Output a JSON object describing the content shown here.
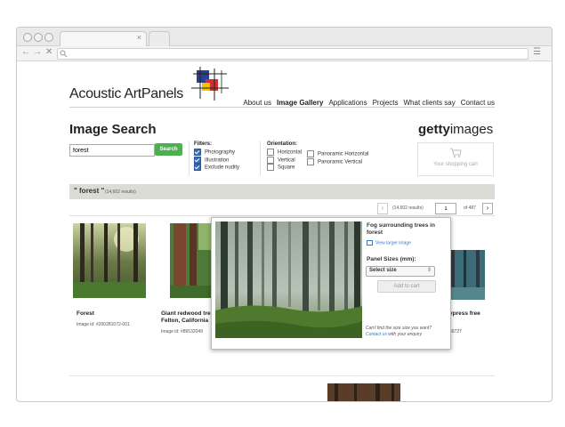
{
  "browser": {
    "tab_close": "×",
    "nav": {
      "back": "←",
      "forward": "→",
      "stop": "✕"
    },
    "url": "",
    "menu_icon": "☰"
  },
  "site": {
    "logo_text": "Acoustic ArtPanels",
    "nav": [
      "About us",
      "Image Gallery",
      "Applications",
      "Projects",
      "What clients say",
      "Contact us"
    ],
    "nav_active_index": 1
  },
  "search": {
    "heading": "Image Search",
    "input_value": "forest",
    "button_label": "Search",
    "filters_label": "Filters:",
    "filters": [
      {
        "label": "Photography",
        "checked": true
      },
      {
        "label": "Illustration",
        "checked": true
      },
      {
        "label": "Exclude nudity",
        "checked": true
      }
    ],
    "orientation_label": "Orientation:",
    "orientation_col1": [
      {
        "label": "Horizontal",
        "checked": false
      },
      {
        "label": "Vertical",
        "checked": false
      },
      {
        "label": "Square",
        "checked": false
      }
    ],
    "orientation_col2": [
      {
        "label": "Panoramic Horizontal",
        "checked": false
      },
      {
        "label": "Panoramic Vertical",
        "checked": false
      }
    ]
  },
  "getty": {
    "bold": "getty",
    "light": "images"
  },
  "cart": {
    "label": "Your shopping cart",
    "icon": "cart-icon"
  },
  "results_bar": {
    "query": "\" forest \"",
    "count": "(14,602 results)"
  },
  "pagination": {
    "prev": "‹",
    "count": "(14,602 results)",
    "page": "1",
    "of": "of 487",
    "next": "›"
  },
  "results": [
    {
      "title": "Forest",
      "id": "Image id: #200281072-001"
    },
    {
      "title": "Giant redwood tre",
      "title2": "Felton, California",
      "id": "Image id: #86532049"
    },
    {
      "title": "ypress free",
      "id": "39727"
    }
  ],
  "popup": {
    "title": "Fog surrounding trees in forest",
    "view_larger": "View larger image",
    "panel_sizes_label": "Panel Sizes (mm):",
    "select_placeholder": "Select size",
    "add_to_cart": "Add to cart",
    "footer_line1": "Can't find the size size you want?",
    "footer_link": "Contact us",
    "footer_rest": " with your enquiry"
  },
  "colors": {
    "search_button": "#4caf50",
    "results_bar": "#dcdcd6",
    "link": "#3a78c2"
  }
}
